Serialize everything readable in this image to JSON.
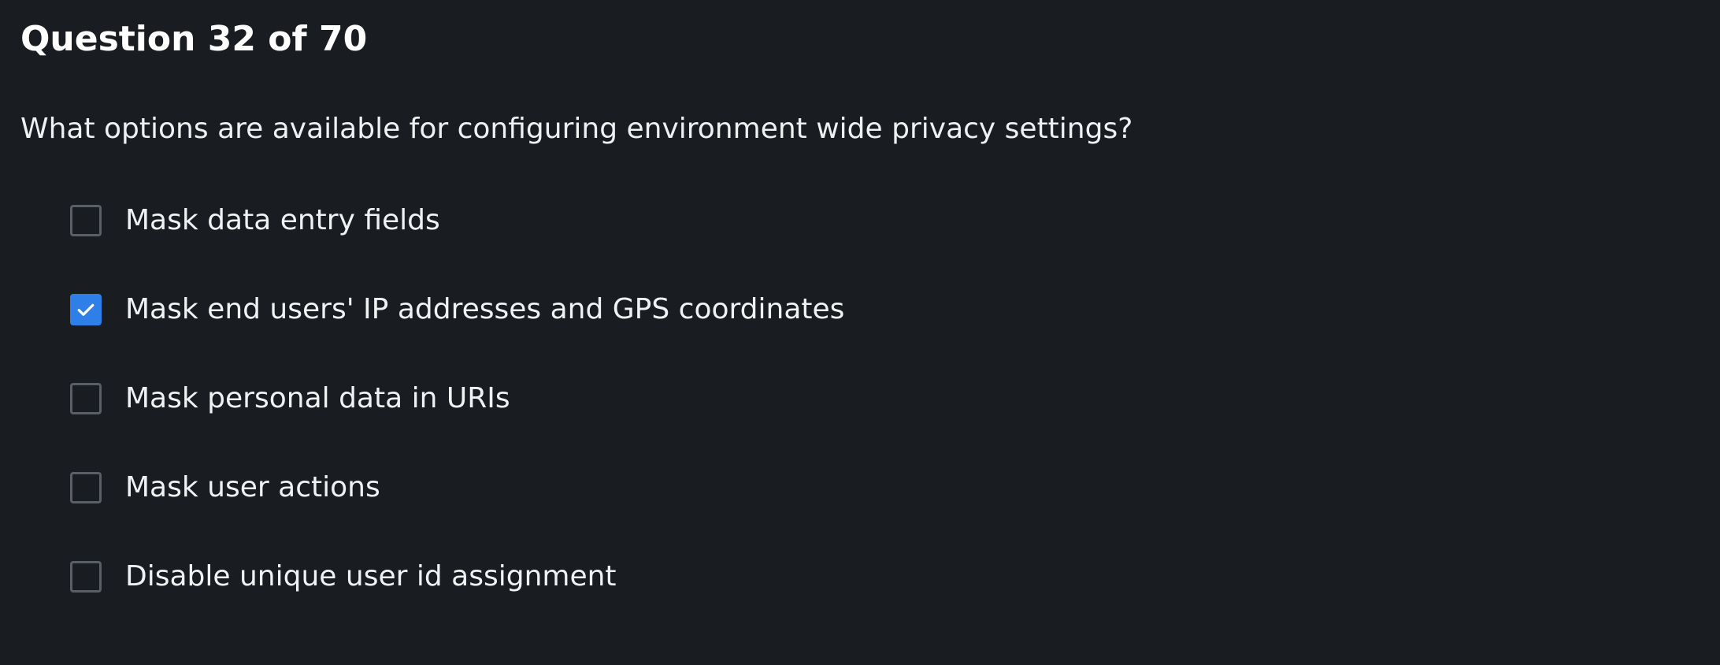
{
  "header": {
    "title": "Question 32 of 70"
  },
  "question": {
    "text": "What options are available for configuring environment wide privacy settings?"
  },
  "options": [
    {
      "label": "Mask data entry fields",
      "checked": false
    },
    {
      "label": "Mask end users' IP addresses and GPS coordinates",
      "checked": true
    },
    {
      "label": "Mask personal data in URIs",
      "checked": false
    },
    {
      "label": "Mask user actions",
      "checked": false
    },
    {
      "label": "Disable unique user id assignment",
      "checked": false
    }
  ],
  "colors": {
    "background": "#191c20",
    "checkbox_border": "#5a5f66",
    "checkbox_checked": "#2f7fe8",
    "text": "#f0f1f3"
  },
  "icons": {
    "checked_mark": "checkmark-icon"
  }
}
